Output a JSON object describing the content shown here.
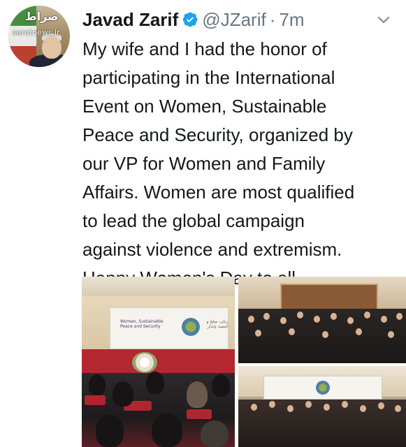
{
  "tweet": {
    "author": {
      "name": "Javad Zarif",
      "handle": "@JZarif",
      "verified": true,
      "avatar_watermark_top": "صراط",
      "avatar_watermark_url": "seratnews.ir"
    },
    "separator": "·",
    "time": "7m",
    "text": "My wife and I had the honor of\nparticipating in the International\nEvent on Women, Sustainable\nPeace and Security, organized by\nour VP for Women and Family\nAffairs. Women are most qualified\nto lead the global campaign\nagainst violence and extremism.\nHappy Women's Day to all.",
    "media": {
      "count": 3,
      "left_banner_english": "Women, Sustainable Peace and Security",
      "left_banner_farsi": "زنان، صلح و امنیت پایدار"
    },
    "icons": {
      "verified": "verified-badge-icon",
      "menu": "chevron-down-icon"
    },
    "colors": {
      "name": "#14171a",
      "meta": "#657786",
      "verified": "#1da1f2"
    }
  }
}
